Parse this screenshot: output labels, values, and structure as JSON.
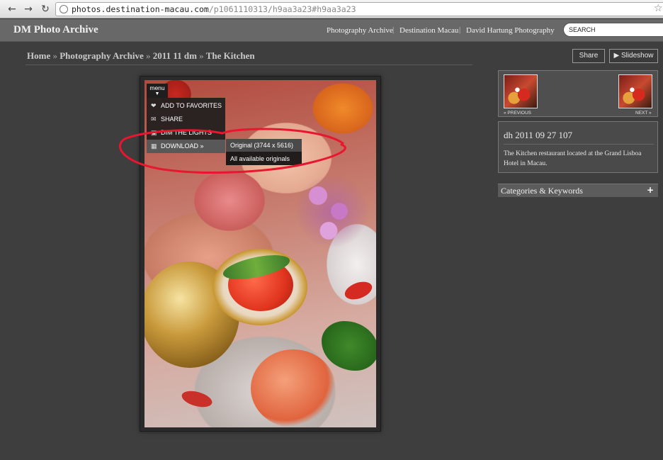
{
  "browser": {
    "url_host": "photos.destination-macau.com",
    "url_path": "/p1061110313/h9aa3a23#h9aa3a23",
    "back_icon": "arrow-left-icon",
    "forward_icon": "arrow-right-icon",
    "reload_icon": "reload-icon",
    "star_icon": "star-icon"
  },
  "header": {
    "site_title": "DM Photo Archive",
    "links": [
      "Photography Archive",
      "Destination Macau",
      "David Hartung Photography"
    ],
    "separator": "|",
    "search_placeholder": "SEARCH"
  },
  "breadcrumb": {
    "items": [
      "Home",
      "Photography Archive",
      "2011 11 dm",
      "The Kitchen"
    ],
    "separator": "»"
  },
  "actions": {
    "share_label": "Share",
    "slideshow_label": "▶ Slideshow"
  },
  "menu": {
    "tab_label": "menu",
    "items": [
      {
        "label": "ADD TO FAVORITES",
        "icon": "heart-icon"
      },
      {
        "label": "SHARE",
        "icon": "envelope-icon"
      },
      {
        "label": "DIM THE LIGHTS",
        "icon": "lightbulb-icon"
      },
      {
        "label": "DOWNLOAD »",
        "icon": "download-icon"
      }
    ],
    "download_submenu": [
      "Original (3744 x 5616)",
      "All available originals"
    ]
  },
  "sidebar": {
    "previous_label": "« PREVIOUS",
    "next_label": "NEXT »",
    "photo_title": "dh 2011 09 27 107",
    "caption": "The Kitchen restaurant located at the Grand Lisboa Hotel in Macau.",
    "categories_label": "Categories & Keywords",
    "categories_toggle": "+"
  },
  "colors": {
    "page_bg": "#3e3e3e",
    "header_bg": "#686868",
    "annotation_red": "#e8162f"
  }
}
